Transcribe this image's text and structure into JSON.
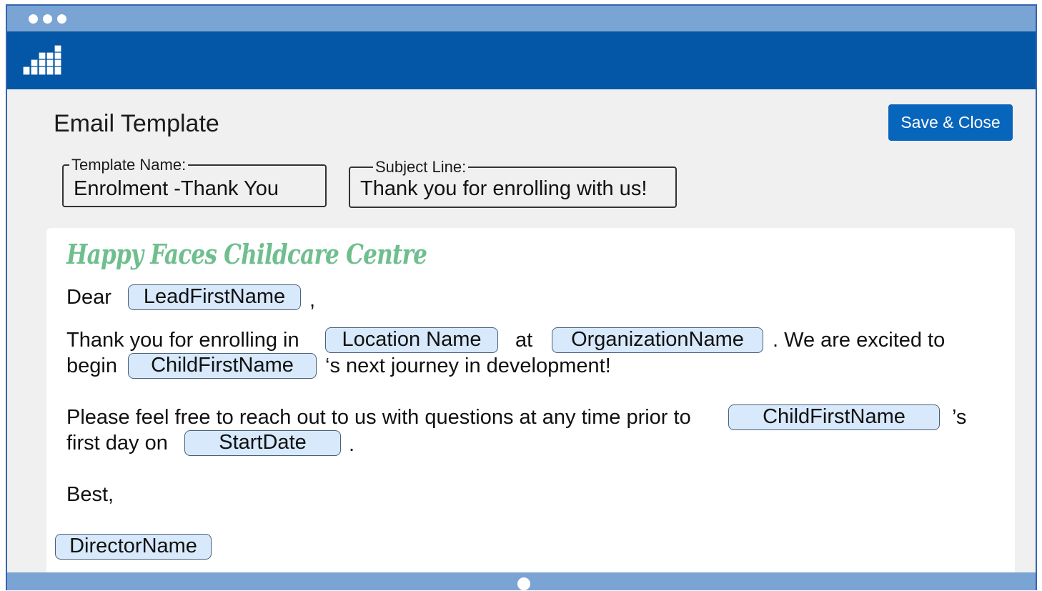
{
  "window": {
    "controls": [
      "window-dot-1",
      "window-dot-2",
      "window-dot-3"
    ]
  },
  "header": {
    "logo_icon": "blocks-logo-icon",
    "color": "#0457a6"
  },
  "page": {
    "title": "Email Template",
    "save_label": "Save & Close"
  },
  "fields": {
    "template_name": {
      "label": "Template Name:",
      "value": "Enrolment -Thank You"
    },
    "subject_line": {
      "label": "Subject Line:",
      "value": "Thank you for enrolling with us!"
    }
  },
  "email": {
    "brand": "Happy Faces Childcare Centre",
    "brand_color": "#6fbf8e",
    "dear": "Dear",
    "comma": ",",
    "lead_first_name": "LeadFirstName",
    "thank_you": "Thank you for enrolling in",
    "location_name": "Location Name",
    "at": "at",
    "organization_name": "OrganizationName",
    "excited": ". We are excited to",
    "begin": "begin",
    "child_first_name": "ChildFirstName",
    "next_journey": "‘s next journey in development!",
    "please": "Please feel free to reach out to us with questions at any time prior to",
    "child_first_name_2": "ChildFirstName",
    "possessive": "’s",
    "first_day": "first day on",
    "start_date": "StartDate",
    "period": ".",
    "best": "Best,",
    "director_name": "DirectorName"
  },
  "colors": {
    "titlebar": "#7aa4d4",
    "button": "#0765bb",
    "token_bg": "#d7e9fb"
  }
}
